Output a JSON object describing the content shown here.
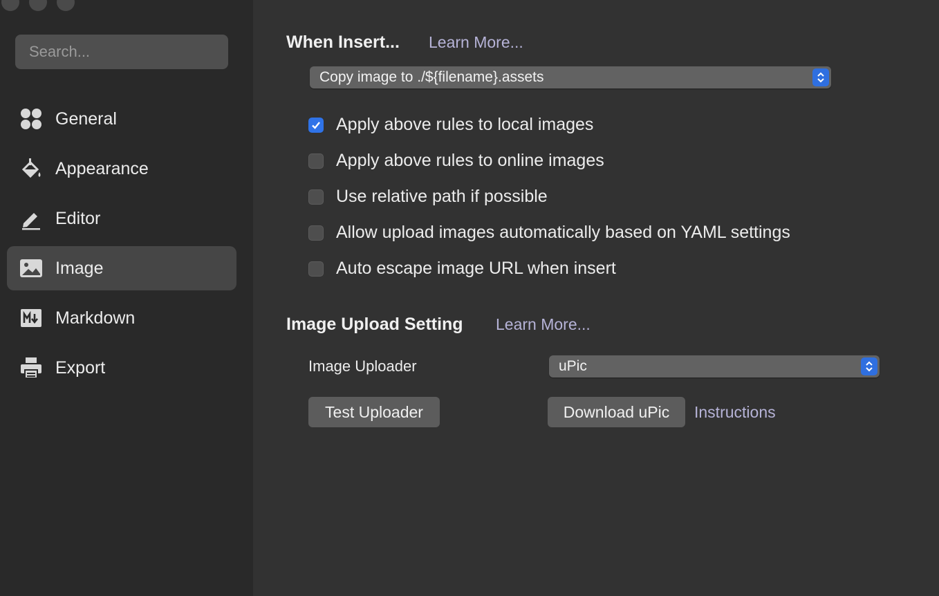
{
  "sidebar": {
    "search_placeholder": "Search...",
    "items": [
      {
        "label": "General",
        "icon": "grid-icon"
      },
      {
        "label": "Appearance",
        "icon": "paint-bucket-icon"
      },
      {
        "label": "Editor",
        "icon": "pen-icon"
      },
      {
        "label": "Image",
        "icon": "image-icon",
        "active": true
      },
      {
        "label": "Markdown",
        "icon": "markdown-icon"
      },
      {
        "label": "Export",
        "icon": "printer-icon"
      }
    ]
  },
  "insert": {
    "title": "When Insert...",
    "learn_more": "Learn More...",
    "select_value": "Copy image to ./${filename}.assets",
    "options": [
      {
        "label": "Apply above rules to local images",
        "checked": true
      },
      {
        "label": "Apply above rules to online images",
        "checked": false
      },
      {
        "label": "Use relative path if possible",
        "checked": false
      },
      {
        "label": "Allow upload images automatically based on YAML settings",
        "checked": false
      },
      {
        "label": "Auto escape image URL when insert",
        "checked": false
      }
    ]
  },
  "upload": {
    "title": "Image Upload Setting",
    "learn_more": "Learn More...",
    "uploader_label": "Image Uploader",
    "uploader_value": "uPic",
    "test_button": "Test Uploader",
    "download_button": "Download uPic",
    "instructions_link": "Instructions"
  },
  "colors": {
    "accent": "#2f73e8",
    "link": "#b6b3d7"
  }
}
